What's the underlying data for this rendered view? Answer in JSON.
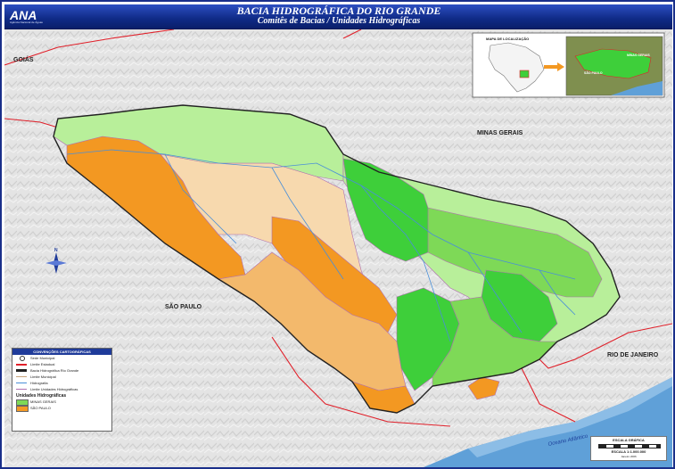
{
  "header": {
    "logo_text": "ANA",
    "agency_text": "Agência Nacional de Águas",
    "title": "BACIA HIDROGRÁFICA DO RIO GRANDE",
    "subtitle": "Comitês de Bacias / Unidades Hidrográficas"
  },
  "map": {
    "states": {
      "goias": "GOIÁS",
      "minas_gerais": "MINAS GERAIS",
      "sao_paulo": "SÃO PAULO",
      "rio_de_janeiro": "RIO DE JANEIRO"
    },
    "ocean_label": "Oceano Atlântico",
    "north_label": "N"
  },
  "location_inset": {
    "title": "MAPA DE LOCALIZAÇÃO",
    "detail_labels": {
      "mg": "MINAS GERAIS",
      "sp": "SÃO PAULO"
    }
  },
  "legend": {
    "title": "CONVENÇÕES CARTOGRÁFICAS",
    "items": [
      {
        "label": "Sede Municipal",
        "color": "#ffffff"
      },
      {
        "label": "Limite Estadual",
        "color": "#e0202a"
      },
      {
        "label": "Bacia Hidrográfica Rio Grande",
        "color": "#222222"
      },
      {
        "label": "Limite Municipal",
        "color": "#c7a27a"
      },
      {
        "label": "Hidrografia",
        "color": "#4a8fd8"
      },
      {
        "label": "Limite Unidades Hidrográficas",
        "color": "#b06fb0"
      }
    ],
    "units_title": "Unidades Hidrográficas",
    "units": [
      {
        "label": "MINAS GERAIS",
        "color": "#7ed957"
      },
      {
        "label": "SÃO PAULO",
        "color": "#f59a25"
      }
    ]
  },
  "scale": {
    "title": "ESCALA GRÁFICA",
    "ratio": "ESCALA 1:1.000.000",
    "date": "Janeiro 2006"
  },
  "colors": {
    "header_blue": "#1a3a9e",
    "mg_light": "#b8ef9a",
    "mg_mid": "#7ed957",
    "mg_dark": "#3ecf3a",
    "sp_light": "#f7d9ae",
    "sp_mid": "#f3b96c",
    "sp_dark": "#f39822",
    "state_boundary": "#e0202a",
    "ocean": "#5fa0d8"
  }
}
